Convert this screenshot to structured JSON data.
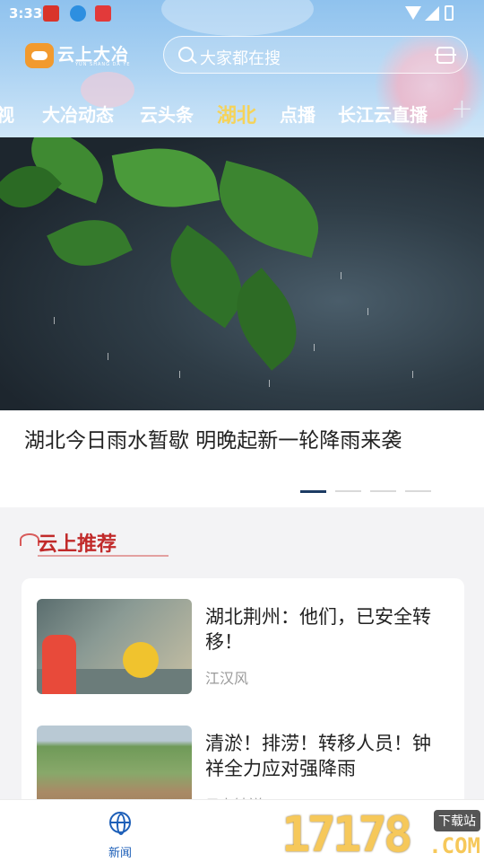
{
  "status_bar": {
    "time": "3:33"
  },
  "header": {
    "logo_text": "云上大冶",
    "logo_subtext": "YUN SHANG DA YE",
    "search_placeholder": "大家都在搜"
  },
  "tabs": [
    {
      "label": "视"
    },
    {
      "label": "大冶动态"
    },
    {
      "label": "云头条"
    },
    {
      "label": "湖北",
      "active": true
    },
    {
      "label": "点播"
    },
    {
      "label": "长江云直播"
    }
  ],
  "tab_add_label": "+",
  "hero": {
    "title": "湖北今日雨水暂歇 明晚起新一轮降雨来袭",
    "slide_count": 4,
    "active_slide": 1
  },
  "recommend": {
    "section_title": "云上推荐",
    "items": [
      {
        "title": "湖北荆州：他们，已安全转移！",
        "source": "江汉风"
      },
      {
        "title": "清淤！排涝！转移人员！钟祥全力应对强降雨",
        "source": "云上钟祥"
      }
    ]
  },
  "bottom_nav": [
    {
      "label": "新闻",
      "icon": "globe-icon",
      "active": true
    }
  ],
  "watermark": {
    "number": "17178",
    "tag": "下载站",
    "domain": ".COM"
  },
  "colors": {
    "accent": "#1d5fb8",
    "tab_active": "#f5d35a",
    "section_title": "#c12a2a"
  }
}
